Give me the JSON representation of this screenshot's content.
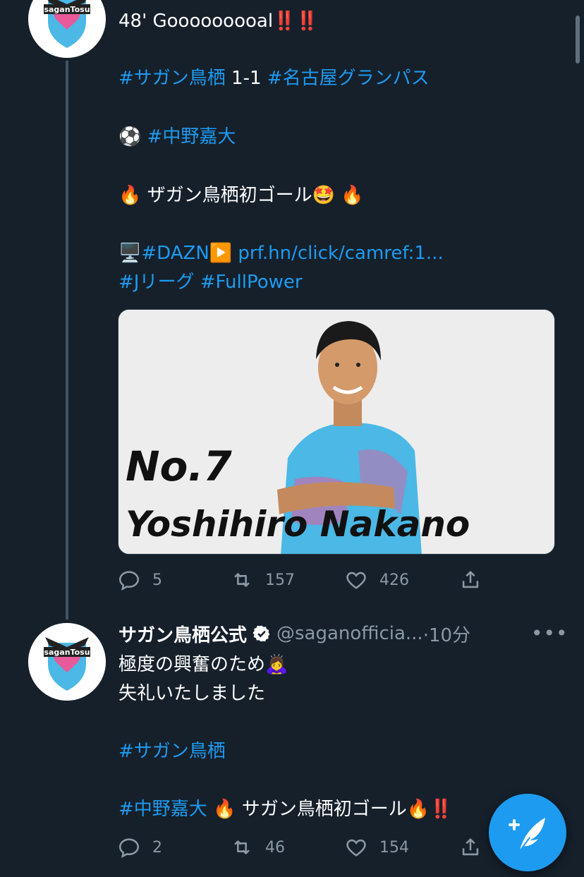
{
  "tweet1": {
    "line1": "48' Gooooooooal",
    "line1_suffix": "‼️‼️",
    "score_tag1": "#サガン鳥栖",
    "score": " 1-1 ",
    "score_tag2": "#名古屋グランパス",
    "ball": "⚽",
    "player_tag": "#中野嘉大",
    "fire": "🔥",
    "first_goal": " ザガン鳥栖初ゴール",
    "star_face": "🤩",
    "monitor": "🖥️",
    "dazn_tag": "#DAZN",
    "play": "▶️",
    "url": " prf.hn/click/camref:1...",
    "jleague_tag": "#Jリーグ",
    "fullpower_tag": " #FullPower",
    "media": {
      "number": "No.7",
      "player": "Yoshihiro Nakano"
    },
    "actions": {
      "replies": "5",
      "retweets": "157",
      "likes": "426"
    }
  },
  "tweet2": {
    "display_name": "サガン鳥栖公式",
    "handle": "@saganofficia...",
    "time": " ·10分",
    "line1": "極度の興奮のため",
    "bow": "🙇‍♀️",
    "line2": "失礼いたしました",
    "tag1": "#サガン鳥栖",
    "tag2": "#中野嘉大",
    "fire": "🔥",
    "goal_text": "サガン鳥栖初ゴール",
    "bang": "‼️",
    "actions": {
      "replies": "2",
      "retweets": "46",
      "likes": "154"
    }
  },
  "icons": [
    "reply-icon",
    "retweet-icon",
    "like-icon",
    "share-icon",
    "verified-icon",
    "more-icon",
    "compose-icon"
  ],
  "colors": {
    "background": "#15202b",
    "link": "#1d9bf0",
    "muted": "#8b98a5",
    "jersey": "#4bb8e6",
    "club_pink": "#e85a9a"
  }
}
